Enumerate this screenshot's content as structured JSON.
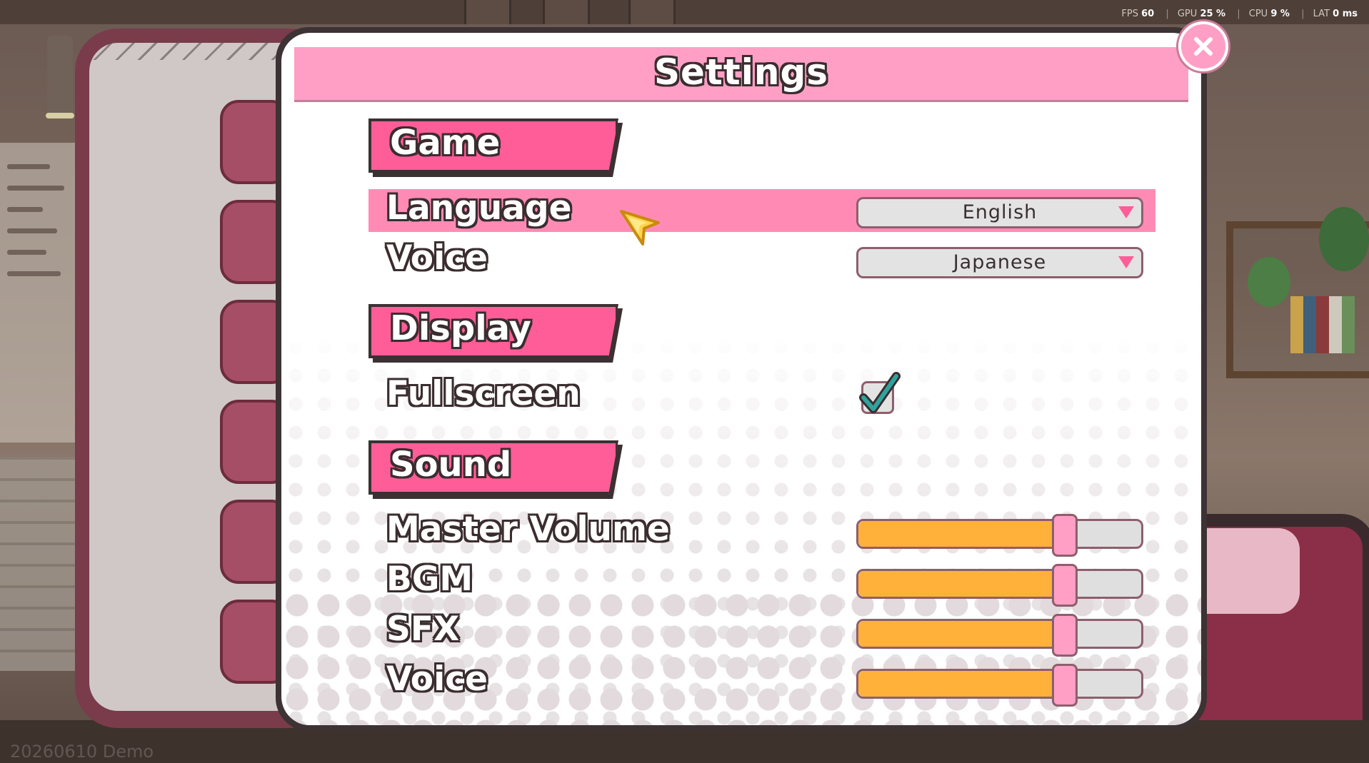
{
  "hud": {
    "fps_label": "FPS",
    "fps_value": "60",
    "gpu_label": "GPU",
    "gpu_value": "25 %",
    "cpu_label": "CPU",
    "cpu_value": "9 %",
    "lat_label": "LAT",
    "lat_value": "0 ms"
  },
  "watermark": "20260610 Demo",
  "settings": {
    "title": "Settings",
    "close_icon": "close-icon",
    "sections": {
      "game": {
        "label": "Game",
        "language": {
          "label": "Language",
          "value": "English"
        },
        "voice": {
          "label": "Voice",
          "value": "Japanese"
        }
      },
      "display": {
        "label": "Display",
        "fullscreen": {
          "label": "Fullscreen",
          "checked": true
        }
      },
      "sound": {
        "label": "Sound",
        "master_volume": {
          "label": "Master Volume",
          "level": 0.73
        },
        "bgm": {
          "label": "BGM",
          "level": 0.73
        },
        "sfx": {
          "label": "SFX",
          "level": 0.73
        },
        "voice": {
          "label": "Voice",
          "level": 0.73
        }
      }
    }
  },
  "colors": {
    "accent_pink": "#ff5d98",
    "header_pink": "#ff9fc5",
    "slider_fill": "#ffb13a",
    "outline": "#3a2d2f"
  }
}
